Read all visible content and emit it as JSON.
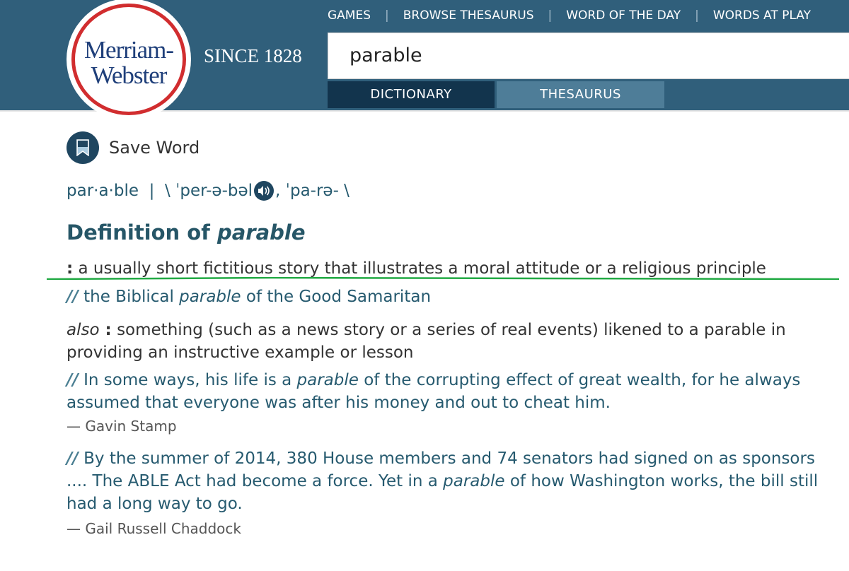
{
  "header": {
    "logo_line1": "Merriam-",
    "logo_line2": "Webster",
    "since": "SINCE 1828",
    "nav": [
      "GAMES",
      "BROWSE THESAURUS",
      "WORD OF THE DAY",
      "WORDS AT PLAY"
    ],
    "search_value": "parable",
    "tabs": [
      "DICTIONARY",
      "THESAURUS"
    ],
    "active_tab": "DICTIONARY"
  },
  "save_word": "Save Word",
  "pronunciation": {
    "syllables": "par·a·ble",
    "sep": "  |  ",
    "p1": "\\ ˈper-ə-bəl",
    "p2": ", ˈpa-rə- \\"
  },
  "heading": {
    "prefix": "Definition of ",
    "word": "parable"
  },
  "definition": {
    "colon": ":",
    "text": " a usually short fictitious story that illustrates a moral attitude or a religious principle"
  },
  "example1": {
    "pre": " the Biblical ",
    "it": "parable",
    "post": " of the Good Samaritan"
  },
  "also": {
    "label": "also",
    "colon": " :",
    "text": " something (such as a news story or a series of real events) likened to a parable in providing an instructive example or lesson"
  },
  "example2": {
    "pre": " In some ways, his life is a ",
    "it": "parable",
    "post": " of the corrupting effect of great wealth, for he always assumed that everyone was after his money and out to cheat him.",
    "author": "— Gavin Stamp"
  },
  "example3": {
    "pre": " By the summer of 2014, 380 House members and 74 senators had signed on as sponsors .... The ABLE Act had become a force. Yet in a ",
    "it": "parable",
    "post": " of how Washington works, the bill still had a long way to go.",
    "author": "— Gail Russell Chaddock"
  },
  "colors": {
    "header": "#305f7b",
    "active_tab": "#12344d",
    "inactive_tab": "#4e7d98",
    "accent_text": "#265667",
    "underline_annotation": "#22aa44"
  }
}
